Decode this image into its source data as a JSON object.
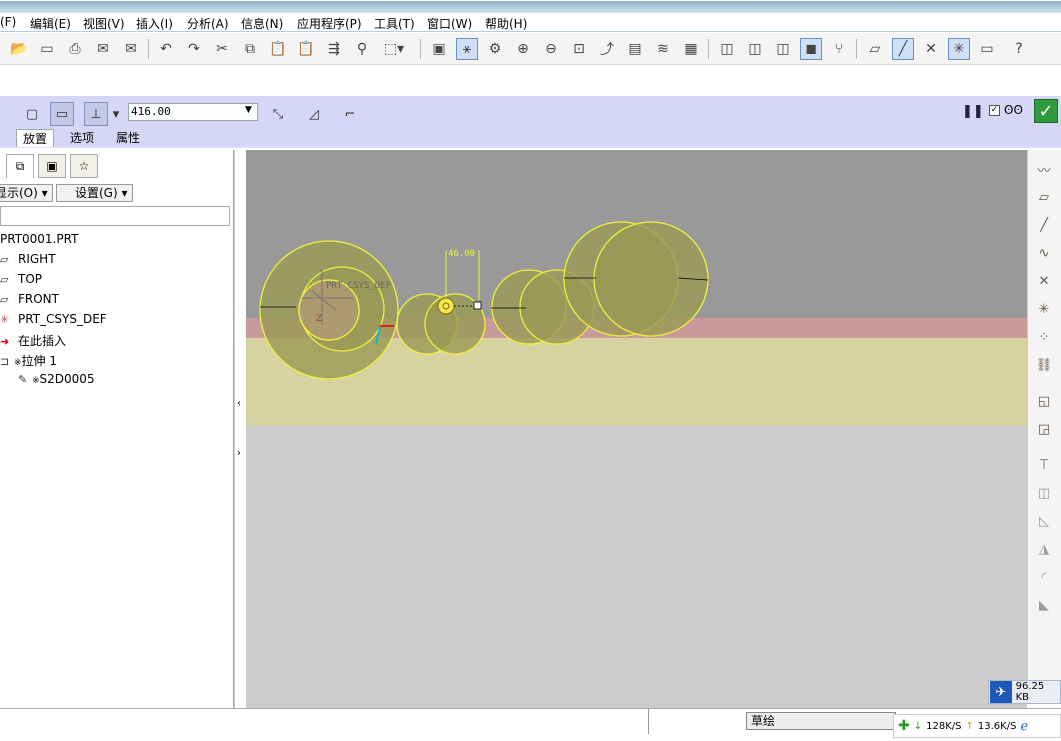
{
  "menubar": {
    "items": [
      "(F)",
      "编辑(E)",
      "视图(V)",
      "插入(I)",
      "分析(A)",
      "信息(N)",
      "应用程序(P)",
      "工具(T)",
      "窗口(W)",
      "帮助(H)"
    ]
  },
  "toolbar": {
    "icons": [
      "open-icon",
      "save-icon",
      "print-icon",
      "email-icon",
      "email-link-icon",
      "undo-icon",
      "redo-icon",
      "cut-icon",
      "copy-icon",
      "paste-icon",
      "paste-special-icon",
      "regenerate-icon",
      "find-icon",
      "select-box-icon",
      "repaint-icon",
      "spin-center-icon",
      "orient-mode-icon",
      "zoom-in-icon",
      "zoom-out-icon",
      "refit-icon",
      "reorient-icon",
      "saved-views-icon",
      "layers-icon",
      "view-manager-icon",
      "wireframe-icon",
      "hidden-line-icon",
      "no-hidden-icon",
      "shading-icon",
      "model-tree-icon",
      "datum-planes-icon",
      "datum-axes-icon",
      "datum-points-icon",
      "coord-sys-icon",
      "annotations-icon",
      "whats-this-icon"
    ]
  },
  "dashboard": {
    "depth_value": "416.00",
    "tabs": [
      "放置",
      "选项",
      "属性"
    ]
  },
  "model_tree": {
    "show_label": "显示(O)",
    "settings_label": "设置(G)",
    "items": [
      {
        "label": "PRT0001.PRT",
        "icon": "part-icon"
      },
      {
        "label": "RIGHT",
        "icon": "datum-plane-icon"
      },
      {
        "label": "TOP",
        "icon": "datum-plane-icon"
      },
      {
        "label": "FRONT",
        "icon": "datum-plane-icon"
      },
      {
        "label": "PRT_CSYS_DEF",
        "icon": "csys-icon"
      },
      {
        "label": "在此插入",
        "icon": "insert-here-icon"
      },
      {
        "label": "拉伸 1",
        "icon": "extrude-icon",
        "prefix": "※"
      },
      {
        "label": "S2D0005",
        "icon": "sketch-icon",
        "prefix": "※"
      }
    ]
  },
  "graphics": {
    "csys_label": "PRT_CSYS_DEF",
    "dimension_label": "46.00",
    "axis_label": "Z"
  },
  "statusbar": {
    "mode": "草绘",
    "download": "128K/S",
    "upload": "13.6K/S",
    "float_speed": "96.25 KB"
  },
  "colors": {
    "dashboard_bg": "#d6d6f6",
    "sketch_fill": "#9a9a55",
    "sketch_outline": "#f0f040",
    "top_plane": "#999999",
    "red_band": "#c99a9a",
    "yellow_plane": "#d6d3a0",
    "ok_green": "#2e9b3e"
  }
}
